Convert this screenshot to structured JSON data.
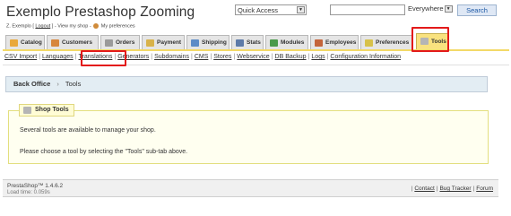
{
  "header": {
    "title": "Exemplo Prestashop Zooming",
    "quick_access": "Quick Access",
    "search_value": "",
    "search_scope": "Everywhere",
    "search_button": "Search"
  },
  "user_line": {
    "name": "Z. Exemplo",
    "logout": "Logout",
    "view_shop": "- View my shop -",
    "preferences": "My preferences"
  },
  "tabs": [
    {
      "label": "Catalog",
      "icon_color": "#e9a83b"
    },
    {
      "label": "Customers",
      "icon_color": "#d7863c"
    },
    {
      "label": "Orders",
      "icon_color": "#9a9a9a"
    },
    {
      "label": "Payment",
      "icon_color": "#d8b24a"
    },
    {
      "label": "Shipping",
      "icon_color": "#5d8cc7"
    },
    {
      "label": "Stats",
      "icon_color": "#5d7aa8"
    },
    {
      "label": "Modules",
      "icon_color": "#4a9a4a"
    },
    {
      "label": "Employees",
      "icon_color": "#c4643a"
    },
    {
      "label": "Preferences",
      "icon_color": "#d7c14a"
    },
    {
      "label": "Tools",
      "icon_color": "#b5b5b5"
    }
  ],
  "subtabs": [
    "CSV Import",
    "Languages",
    "Translations",
    "Generators",
    "Subdomains",
    "CMS",
    "Stores",
    "Webservice",
    "DB Backup",
    "Logs",
    "Configuration Information"
  ],
  "breadcrumb": {
    "root": "Back Office",
    "current": "Tools"
  },
  "panel": {
    "legend": "Shop Tools",
    "p1": "Several tools are available to manage your shop.",
    "p2": "Please choose a tool by selecting the \"Tools\" sub-tab above."
  },
  "footer": {
    "version": "PrestaShop™ 1.4.6.2",
    "load_time": "Load time: 0.059s",
    "contact": "Contact",
    "bug_tracker": "Bug Tracker",
    "forum": "Forum"
  },
  "colors": {
    "highlight": "#e31a1a",
    "active_tab": "#f9e27f",
    "breadcrumb_bg": "#e3edf3"
  }
}
